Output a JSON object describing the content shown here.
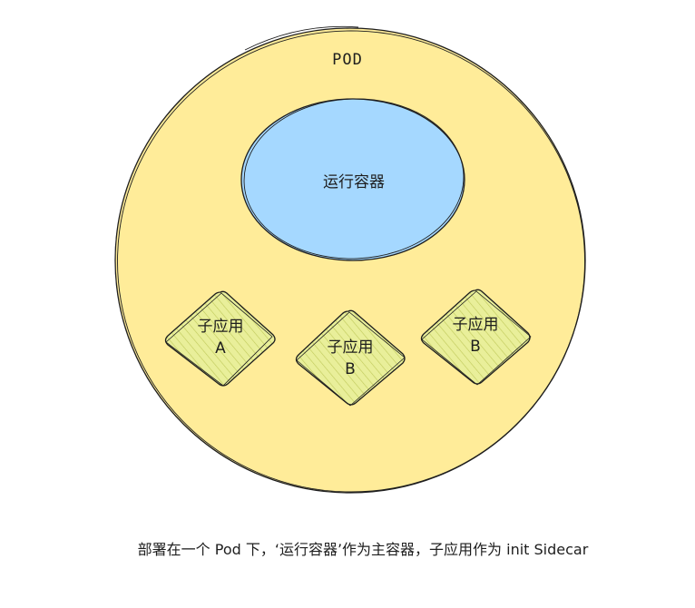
{
  "pod": {
    "title": "POD",
    "fill": "#ffec99",
    "stroke": "#1e1e1e"
  },
  "runtime_container": {
    "label": "运行容器",
    "fill": "#a5d8ff"
  },
  "sub_apps": [
    {
      "name": "子应用",
      "variant": "A"
    },
    {
      "name": "子应用",
      "variant": "B"
    },
    {
      "name": "子应用",
      "variant": "B"
    }
  ],
  "sub_app_style": {
    "fill": "#e9ef9a",
    "hachure": "#c0c95a"
  },
  "caption": "部署在一个 Pod 下，‘运行容器’作为主容器，子应用作为 init Sidecar"
}
